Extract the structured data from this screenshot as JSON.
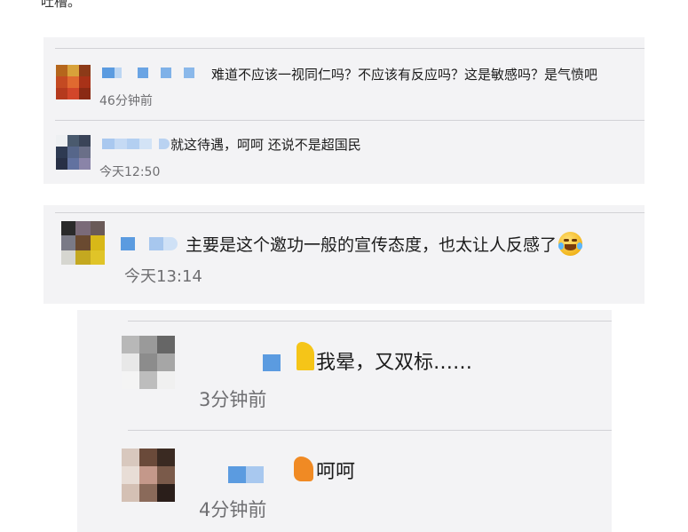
{
  "page": {
    "top_text": "吐槽。"
  },
  "comments_a": [
    {
      "message": "难道不应该一视同仁吗？不应该有反应吗？这是敏感吗？是气愤吧",
      "time": "46分钟前"
    },
    {
      "message": "就这待遇，呵呵 还说不是超国民",
      "time": "今天12:50"
    }
  ],
  "comment_b": {
    "message": "主要是这个邀功一般的宣传态度，也太让人反感了",
    "time": "今天13:14",
    "emoji": "laughing-crying-emoji"
  },
  "comments_c": [
    {
      "message": "我晕，又双标……",
      "time": "3分钟前"
    },
    {
      "message": "呵呵",
      "time": "4分钟前"
    }
  ],
  "colors": {
    "panel_bg": "#f3f3f5",
    "divider": "#d2d2d6",
    "time_text": "#6f6f72",
    "name_mosaic_blue": "#5b9be0"
  }
}
